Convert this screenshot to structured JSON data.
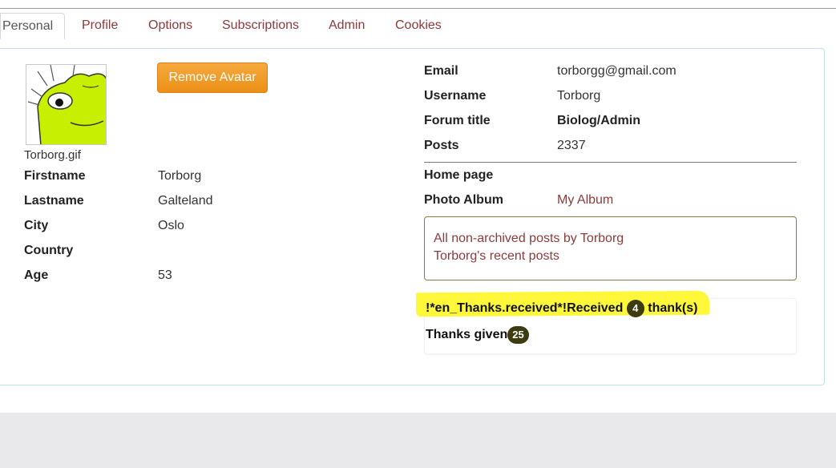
{
  "tabs": [
    {
      "label": "Personal"
    },
    {
      "label": "Profile"
    },
    {
      "label": "Options"
    },
    {
      "label": "Subscriptions"
    },
    {
      "label": "Admin"
    },
    {
      "label": "Cookies"
    }
  ],
  "avatar": {
    "filename": "Torborg.gif",
    "remove_label": "Remove Avatar"
  },
  "personal": {
    "firstname_label": "Firstname",
    "firstname": "Torborg",
    "lastname_label": "Lastname",
    "lastname": "Galteland",
    "city_label": "City",
    "city": "Oslo",
    "country_label": "Country",
    "country": "",
    "age_label": "Age",
    "age": "53"
  },
  "account": {
    "email_label": "Email",
    "email": "torborgg@gmail.com",
    "username_label": "Username",
    "username": "Torborg",
    "forum_title_label": "Forum title",
    "forum_title": "Biolog/Admin",
    "posts_label": "Posts",
    "posts": "2337",
    "homepage_label": "Home page",
    "homepage": "",
    "album_label": "Photo Album",
    "album_link": "My Album"
  },
  "links": {
    "all_posts": "All non-archived posts by Torborg",
    "recent_posts": "Torborg's recent posts"
  },
  "thanks": {
    "received_prefix": "!*en_Thanks.received*!Received",
    "received_count": "4",
    "received_suffix": "thank(s)",
    "given_label": "Thanks given",
    "given_count": "25"
  },
  "colors": {
    "link": "#8b3a3a",
    "button": "#ec8f17",
    "badge": "#3d3b10",
    "highlight": "#fff83a",
    "panel_border": "#bfe3ec"
  }
}
